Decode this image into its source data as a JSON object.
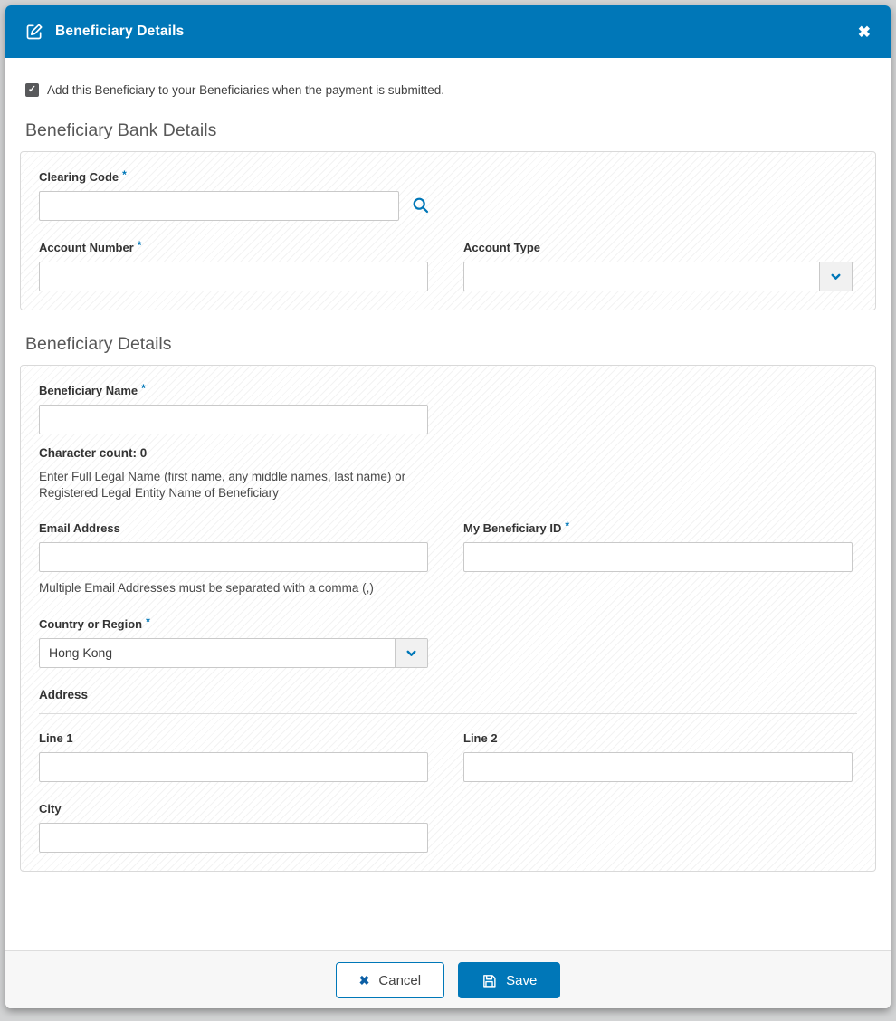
{
  "colors": {
    "primary_blue": "#0077b8",
    "header_bg": "#0077b8",
    "page_bg": "#d2d3d4",
    "footer_bg": "#f7f7f7",
    "checkbox_bg": "#58595b"
  },
  "icons": {
    "edit": "pencil-square",
    "close": "✖",
    "check": "✓",
    "search": "magnifier",
    "chevron_down": "chevron-down",
    "cancel_x": "✖",
    "save": "floppy-disk"
  },
  "header": {
    "title": "Beneficiary Details"
  },
  "add_checkbox": {
    "checked": true,
    "label": "Add this Beneficiary to your Beneficiaries when the payment is submitted."
  },
  "required_marker": "*",
  "bank_section": {
    "heading": "Beneficiary Bank Details",
    "clearing_code": {
      "label": "Clearing Code",
      "required": true,
      "value": ""
    },
    "account_number": {
      "label": "Account Number",
      "required": true,
      "value": ""
    },
    "account_type": {
      "label": "Account Type",
      "required": false,
      "value": ""
    }
  },
  "beneficiary_section": {
    "heading": "Beneficiary Details",
    "beneficiary_name": {
      "label": "Beneficiary Name",
      "required": true,
      "value": "",
      "char_count": "Character count: 0",
      "help": "Enter Full Legal Name (first name, any middle names, last name) or Registered Legal Entity Name of Beneficiary"
    },
    "email_address": {
      "label": "Email Address",
      "required": false,
      "value": "",
      "help": "Multiple Email Addresses must be separated with a comma (,)"
    },
    "my_beneficiary_id": {
      "label": "My Beneficiary ID",
      "required": true,
      "value": ""
    },
    "country_or_region": {
      "label": "Country or Region",
      "required": true,
      "value": "Hong Kong"
    },
    "address": {
      "heading": "Address",
      "line1": {
        "label": "Line 1",
        "value": ""
      },
      "line2": {
        "label": "Line 2",
        "value": ""
      },
      "city": {
        "label": "City",
        "value": ""
      }
    }
  },
  "footer": {
    "cancel_label": "Cancel",
    "save_label": "Save"
  }
}
